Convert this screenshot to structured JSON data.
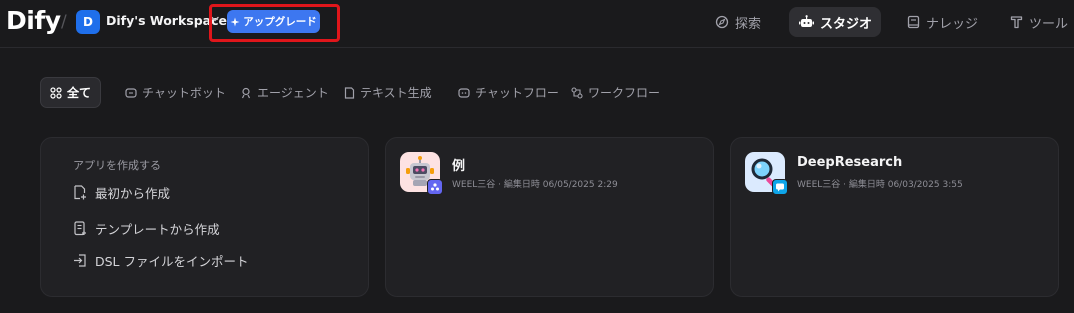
{
  "header": {
    "logo": "Dify",
    "separator": "/",
    "workspace": {
      "initial": "D",
      "name": "Dify's Workspace"
    },
    "upgrade_label": "アップグレード",
    "nav": [
      {
        "label": "探索",
        "icon": "explore-icon",
        "active": false
      },
      {
        "label": "スタジオ",
        "icon": "robot-icon",
        "active": true
      },
      {
        "label": "ナレッジ",
        "icon": "book-icon",
        "active": false
      },
      {
        "label": "ツール",
        "icon": "tool-icon",
        "active": false
      }
    ]
  },
  "tabs": [
    {
      "label": "全て",
      "icon": "grid-icon",
      "active": true
    },
    {
      "label": "チャットボット",
      "icon": "chat-icon",
      "active": false
    },
    {
      "label": "エージェント",
      "icon": "agent-icon",
      "active": false
    },
    {
      "label": "テキスト生成",
      "icon": "document-icon",
      "active": false
    },
    {
      "label": "チャットフロー",
      "icon": "chatflow-icon",
      "active": false
    },
    {
      "label": "ワークフロー",
      "icon": "workflow-icon",
      "active": false
    }
  ],
  "create_card": {
    "title": "アプリを作成する",
    "items": [
      {
        "label": "最初から作成",
        "icon": "file-plus-icon"
      },
      {
        "label": "テンプレートから作成",
        "icon": "template-icon"
      },
      {
        "label": "DSL ファイルをインポート",
        "icon": "import-icon"
      }
    ]
  },
  "apps": [
    {
      "name": "例",
      "meta": "WEEL三谷 · 編集日時 06/05/2025 2:29",
      "icon": "robot-app-icon",
      "badge": "agent-badge-icon",
      "badge_color": "#6366f1",
      "icon_bg": "#fde2e2"
    },
    {
      "name": "DeepResearch",
      "meta": "WEEL三谷 · 編集日時 06/03/2025 3:55",
      "icon": "magnifier-app-icon",
      "badge": "chatflow-badge-icon",
      "badge_color": "#0ea5e9",
      "icon_bg": "#dbeafe"
    }
  ],
  "colors": {
    "accent": "#3d77f0",
    "highlight": "#e0161b",
    "background": "#1a1a1c"
  }
}
